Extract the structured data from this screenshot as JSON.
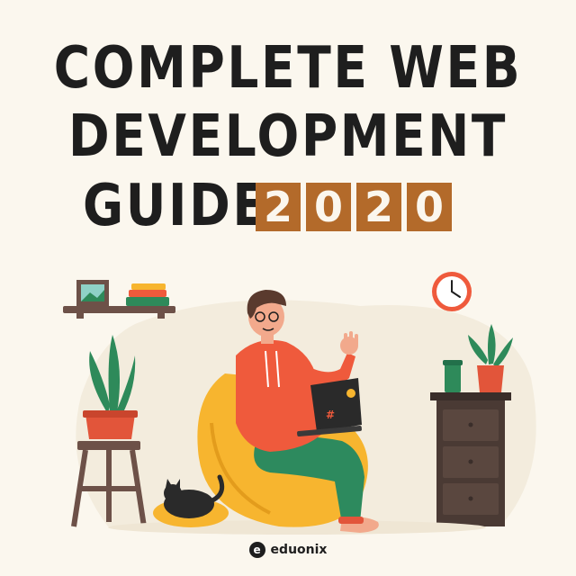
{
  "poster": {
    "title_line1": "COMPLETE WEB",
    "title_line2": "DEVELOPMENT",
    "title_line3": "GUIDE",
    "year_digits": [
      "2",
      "0",
      "2",
      "0"
    ]
  },
  "brand": {
    "name": "eduonix",
    "mark": "e"
  },
  "colors": {
    "background": "#fbf7ee",
    "title": "#1e1e1e",
    "year_badge": "#b36a2a",
    "hoodie": "#ef5a3c",
    "pants": "#2d8a5e",
    "beanbag": "#f7b52f",
    "cabinet": "#4a3a34",
    "plant_green": "#2e8a5a",
    "pot": "#e2553a"
  }
}
